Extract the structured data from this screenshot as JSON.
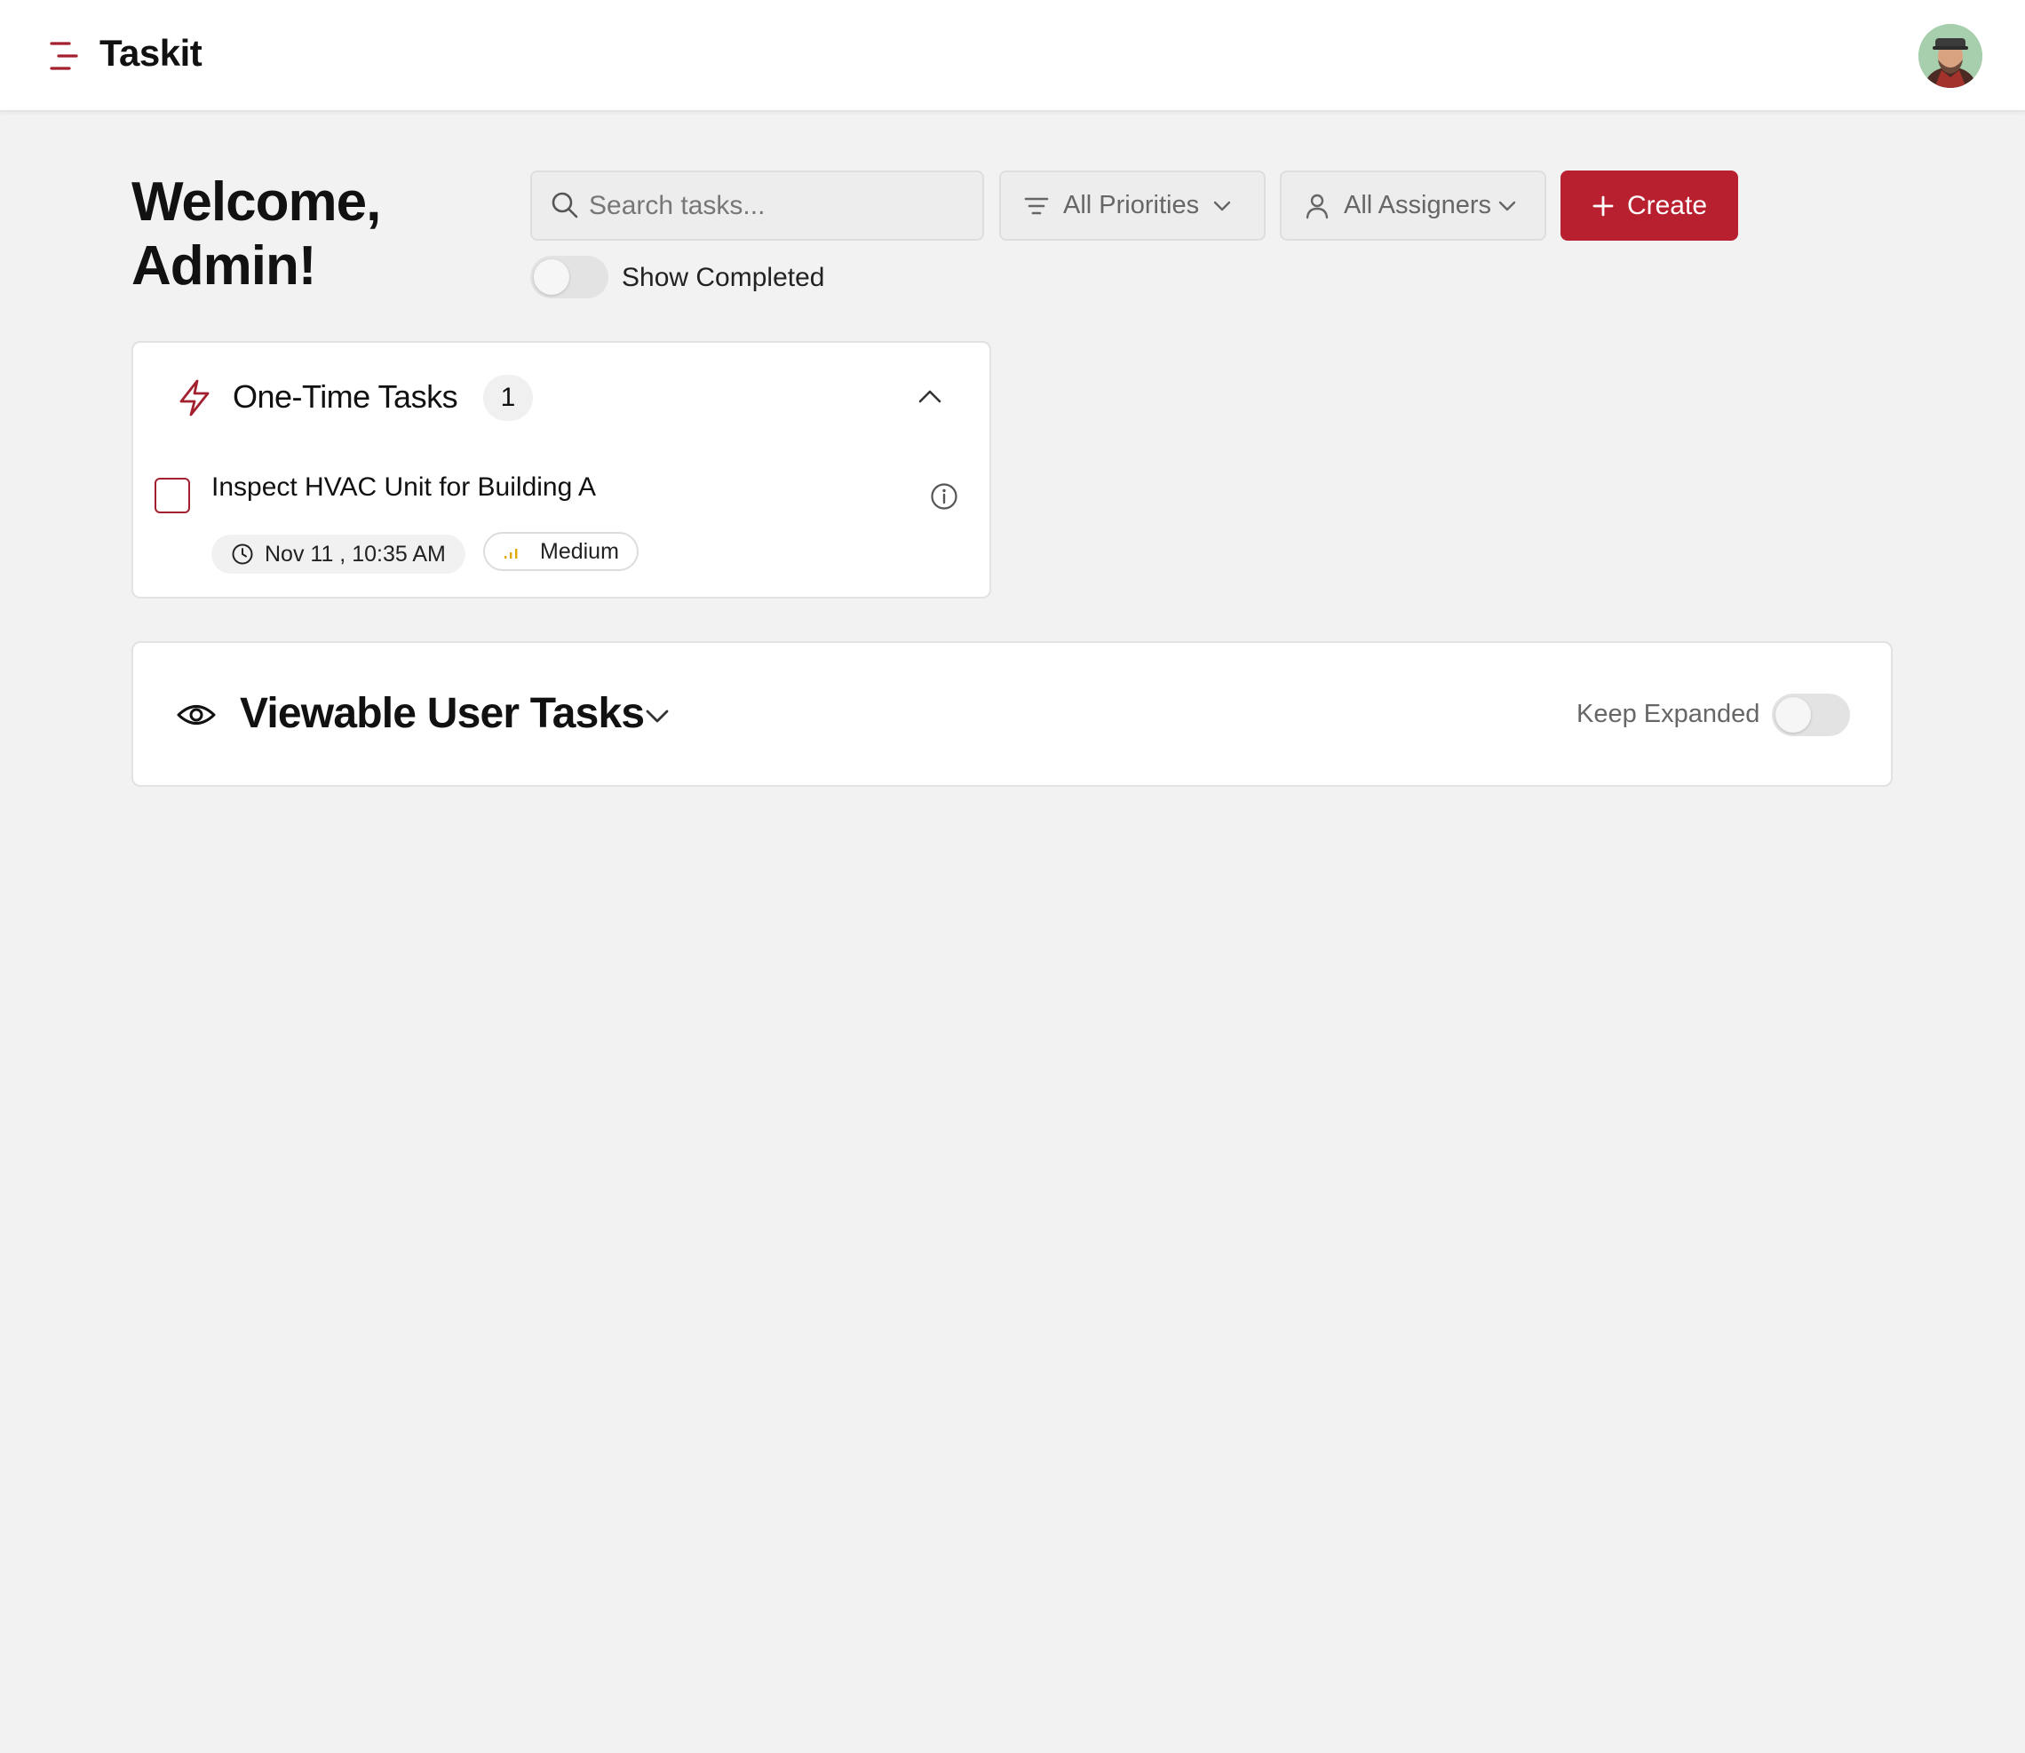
{
  "app": {
    "title": "Taskit",
    "accent_color": "#b8202f"
  },
  "header": {
    "menu_icon": "menu-icon",
    "avatar_icon": "user-avatar"
  },
  "welcome": {
    "line1": "Welcome,",
    "line2": "Admin!"
  },
  "toolbar": {
    "search_placeholder": "Search tasks...",
    "search_value": "",
    "priority_filter": "All Priorities",
    "assigner_filter": "All Assigners",
    "create_label": "Create",
    "show_completed_label": "Show Completed",
    "show_completed_on": false
  },
  "one_time_tasks": {
    "title": "One-Time Tasks",
    "count": "1",
    "icon": "bolt-icon",
    "expanded": true,
    "tasks": [
      {
        "title": "Inspect HVAC Unit for Building A",
        "due": "Nov 11 , 10:35 AM",
        "priority": "Medium",
        "priority_color": "#e0a800",
        "completed": false
      }
    ]
  },
  "viewable_user_tasks": {
    "title": "Viewable User Tasks",
    "icon": "eye-icon",
    "keep_expanded_label": "Keep Expanded",
    "keep_expanded_on": false
  }
}
